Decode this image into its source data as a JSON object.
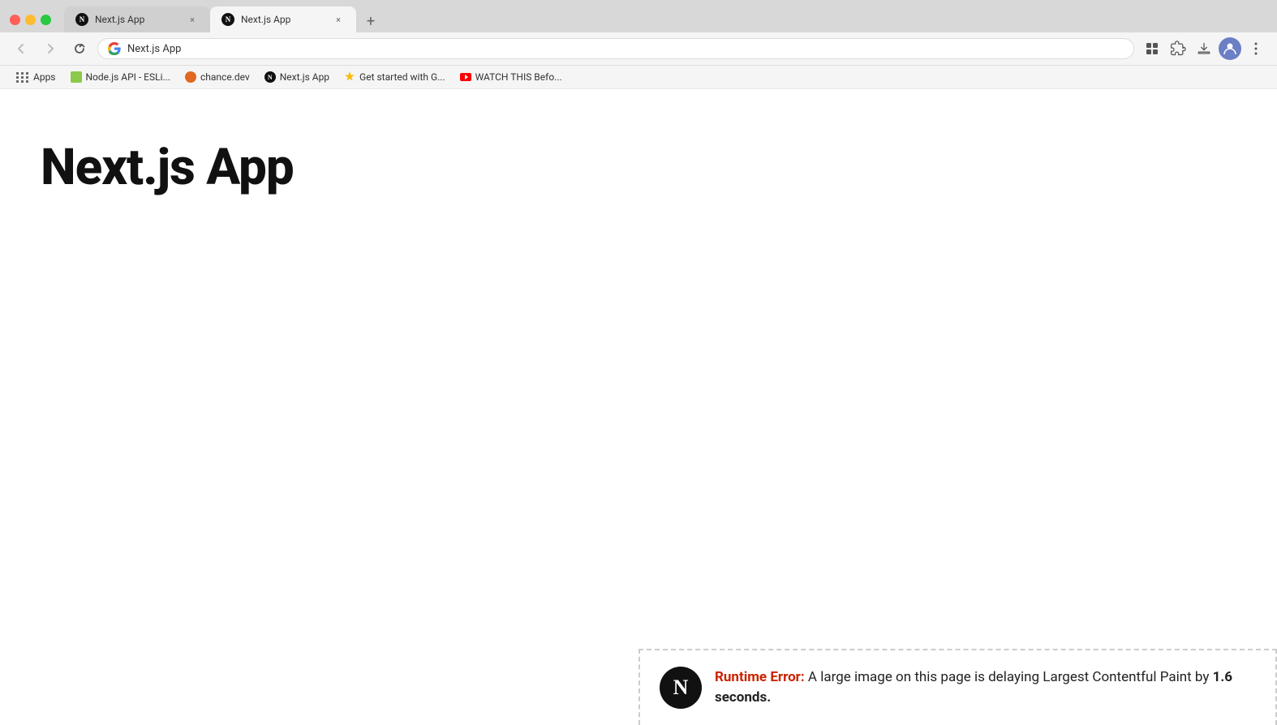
{
  "browser": {
    "tabs": [
      {
        "id": "tab1",
        "title": "Next.js App",
        "active": false,
        "favicon_type": "nextjs"
      },
      {
        "id": "tab2",
        "title": "Next.js App",
        "active": true,
        "favicon_type": "nextjs"
      }
    ],
    "new_tab_label": "+",
    "address_bar": {
      "url": "Next.js App",
      "favicon": "google"
    },
    "toolbar_icons": {
      "back": "←",
      "forward": "→",
      "refresh": "↻",
      "extensions": "⊞",
      "more": "⋮"
    }
  },
  "bookmarks": {
    "apps_label": "Apps",
    "items": [
      {
        "id": "bm1",
        "title": "Node.js API - ESLi...",
        "favicon_type": "nodejs"
      },
      {
        "id": "bm2",
        "title": "chance.dev",
        "favicon_type": "orange"
      },
      {
        "id": "bm3",
        "title": "Next.js App",
        "favicon_type": "nextjs"
      },
      {
        "id": "bm4",
        "title": "Get started with G...",
        "favicon_type": "arrow"
      },
      {
        "id": "bm5",
        "title": "WATCH THIS Befo...",
        "favicon_type": "youtube"
      }
    ]
  },
  "page": {
    "heading": "Next.js App"
  },
  "error_overlay": {
    "logo_letter": "N",
    "label": "Runtime Error:",
    "message_before_bold": " A large image on this page is delaying Largest Contentful Paint by ",
    "bold_text": "1.6 seconds.",
    "full_message": " A large image on this page is delaying Largest Contentful Paint by 1.6 seconds."
  }
}
